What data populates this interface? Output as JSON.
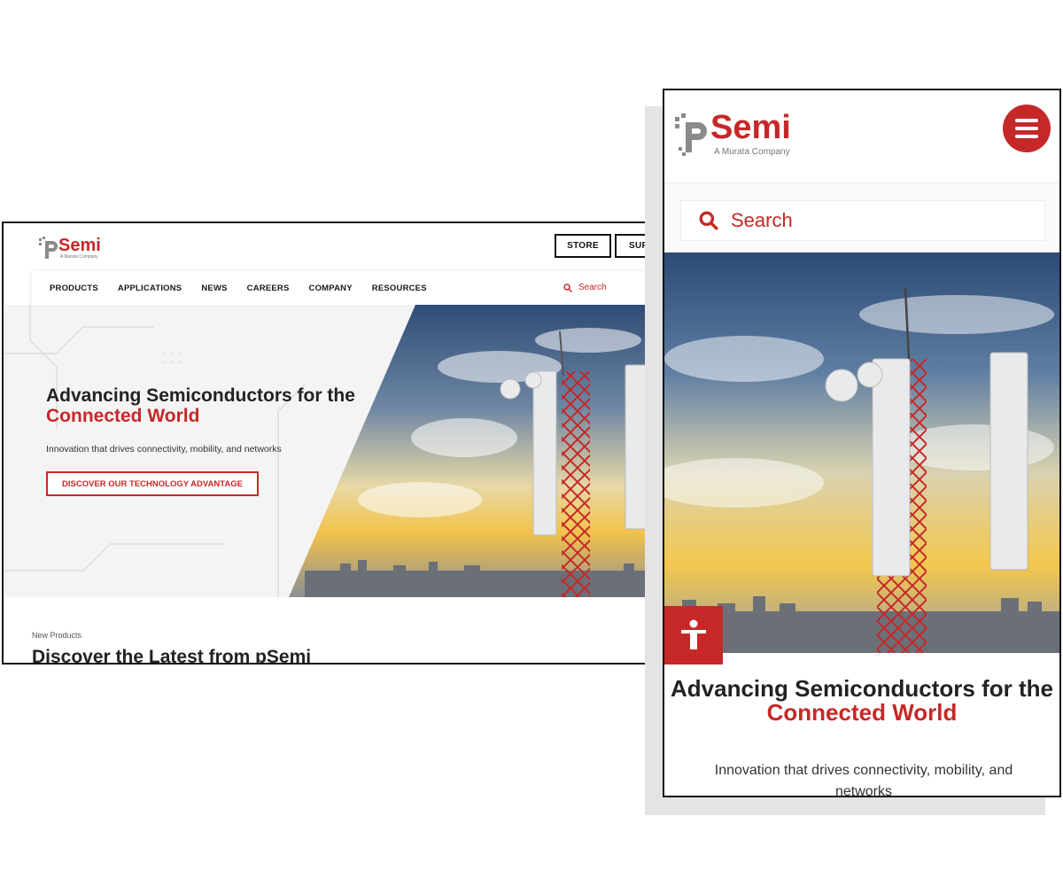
{
  "brand": {
    "name": "pSemi",
    "tagline": "A Murata Company",
    "accent": "#c62828",
    "text_dark": "#222222"
  },
  "desktop": {
    "top_buttons": [
      "STORE",
      "SUPPORT"
    ],
    "nav": [
      "PRODUCTS",
      "APPLICATIONS",
      "NEWS",
      "CAREERS",
      "COMPANY",
      "RESOURCES"
    ],
    "search_placeholder": "Search",
    "hero": {
      "title_part1": "Advancing Semiconductors for the ",
      "title_highlight": "Connected World",
      "subtitle": "Innovation that drives connectivity, mobility, and networks",
      "cta": "DISCOVER OUR TECHNOLOGY ADVANTAGE"
    },
    "section": {
      "eyebrow": "New Products",
      "heading": "Discover the Latest from pSemi"
    }
  },
  "mobile": {
    "search_placeholder": "Search",
    "hero": {
      "title_part1": "Advancing Semiconductors for the ",
      "title_highlight": "Connected World",
      "subtitle": "Innovation that drives connectivity, mobility, and networks"
    },
    "icons": {
      "menu": "hamburger-menu-icon",
      "search": "search-icon",
      "accessibility": "accessibility-icon"
    }
  }
}
